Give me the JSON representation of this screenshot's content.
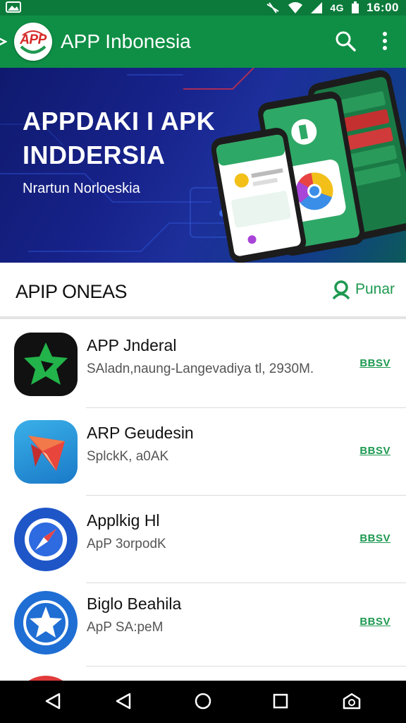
{
  "status_bar": {
    "time": "16:00",
    "network_label": "4G",
    "icons": [
      "gallery-icon",
      "vibrate-icon",
      "wifi-icon",
      "signal-icon",
      "battery-icon"
    ]
  },
  "toolbar": {
    "logo_text": "APP",
    "title": "APP Inbonesia",
    "icons": [
      "search-icon",
      "more-vert-icon"
    ]
  },
  "banner": {
    "title_line1": "APPDAKI I APK",
    "title_line2": "INDDERSIA",
    "subtitle": "Nrartun Norloeskia"
  },
  "section": {
    "title": "APIP ONEAS",
    "action_label": "Punar"
  },
  "apps": [
    {
      "name": "APP Jnderal",
      "meta": "SAladn,naung-Langevadiya tl, 2930M.",
      "action": "BBSV",
      "icon": "green-star-app-icon"
    },
    {
      "name": "ARP Geudesin",
      "meta": "SplckK, a0AK",
      "action": "BBSV",
      "icon": "paper-plane-app-icon"
    },
    {
      "name": "Applkig Hl",
      "meta": "ApP 3orpodK",
      "action": "BBSV",
      "icon": "compass-app-icon"
    },
    {
      "name": "Biglo Beahila",
      "meta": "ApP SA:peM",
      "action": "BBSV",
      "icon": "star-app-icon"
    }
  ],
  "colors": {
    "status_bar": "#0b7a3a",
    "toolbar": "#0f8f45",
    "accent_green": "#1e9950",
    "banner_dark": "#17228a"
  },
  "nav_bar": {
    "icons": [
      "back-icon",
      "back-icon-alt",
      "home-icon",
      "recents-icon",
      "screenshot-icon"
    ]
  }
}
